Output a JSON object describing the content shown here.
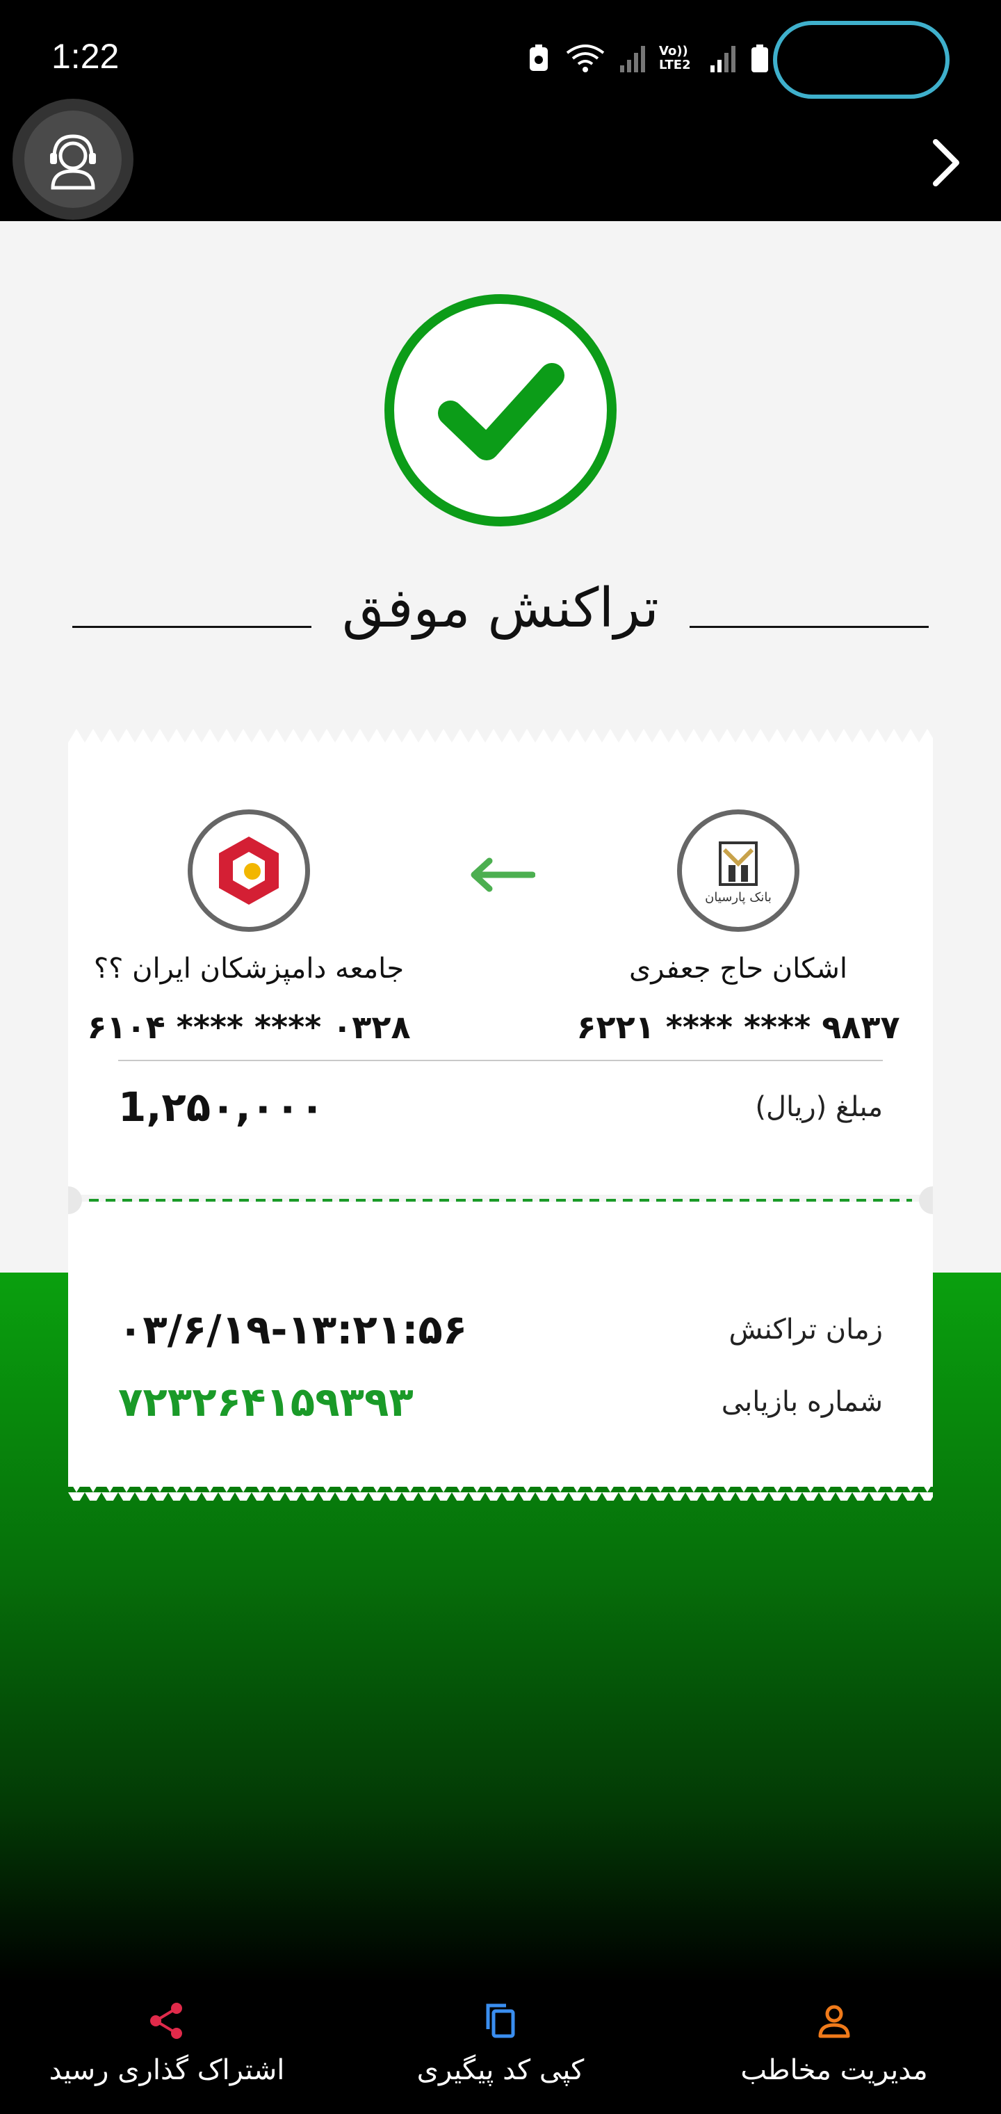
{
  "status_bar": {
    "time": "1:22",
    "lte_label": "Vo)) LTE2"
  },
  "title": "تراکنش موفق",
  "source": {
    "name": "اشکان  حاج جعفری",
    "card_number": "۶۲۲۱ **** **** ۹۸۳۷",
    "bank_logo_text": "بانک پارسیان",
    "logo_icon": "parsian-bank-logo"
  },
  "destination": {
    "name": "جامعه دامپزشکان ایران  ؟؟",
    "card_number": "۶۱۰۴ **** **** ۰۳۲۸",
    "logo_icon": "mellat-bank-logo"
  },
  "amount": {
    "label": "مبلغ (ریال)",
    "value": "1,۲۵۰,۰۰۰"
  },
  "transaction_time": {
    "label": "زمان تراکنش",
    "value": "۰۳/۶/۱۹-۱۳:۲۱:۵۶"
  },
  "tracking": {
    "label": "شماره بازیابی",
    "value": "۷۲۳۲۶۴۱۵۹۳۹۳"
  },
  "bottom_bar": {
    "contacts": "مدیریت مخاطب",
    "copy": "کپی کد پیگیری",
    "share": "اشتراک گذاری رسید"
  },
  "colors": {
    "success_green": "#0c9c18",
    "share_icon": "#e02a4a",
    "copy_icon": "#3a8ef0",
    "contacts_icon": "#f07a1a"
  }
}
